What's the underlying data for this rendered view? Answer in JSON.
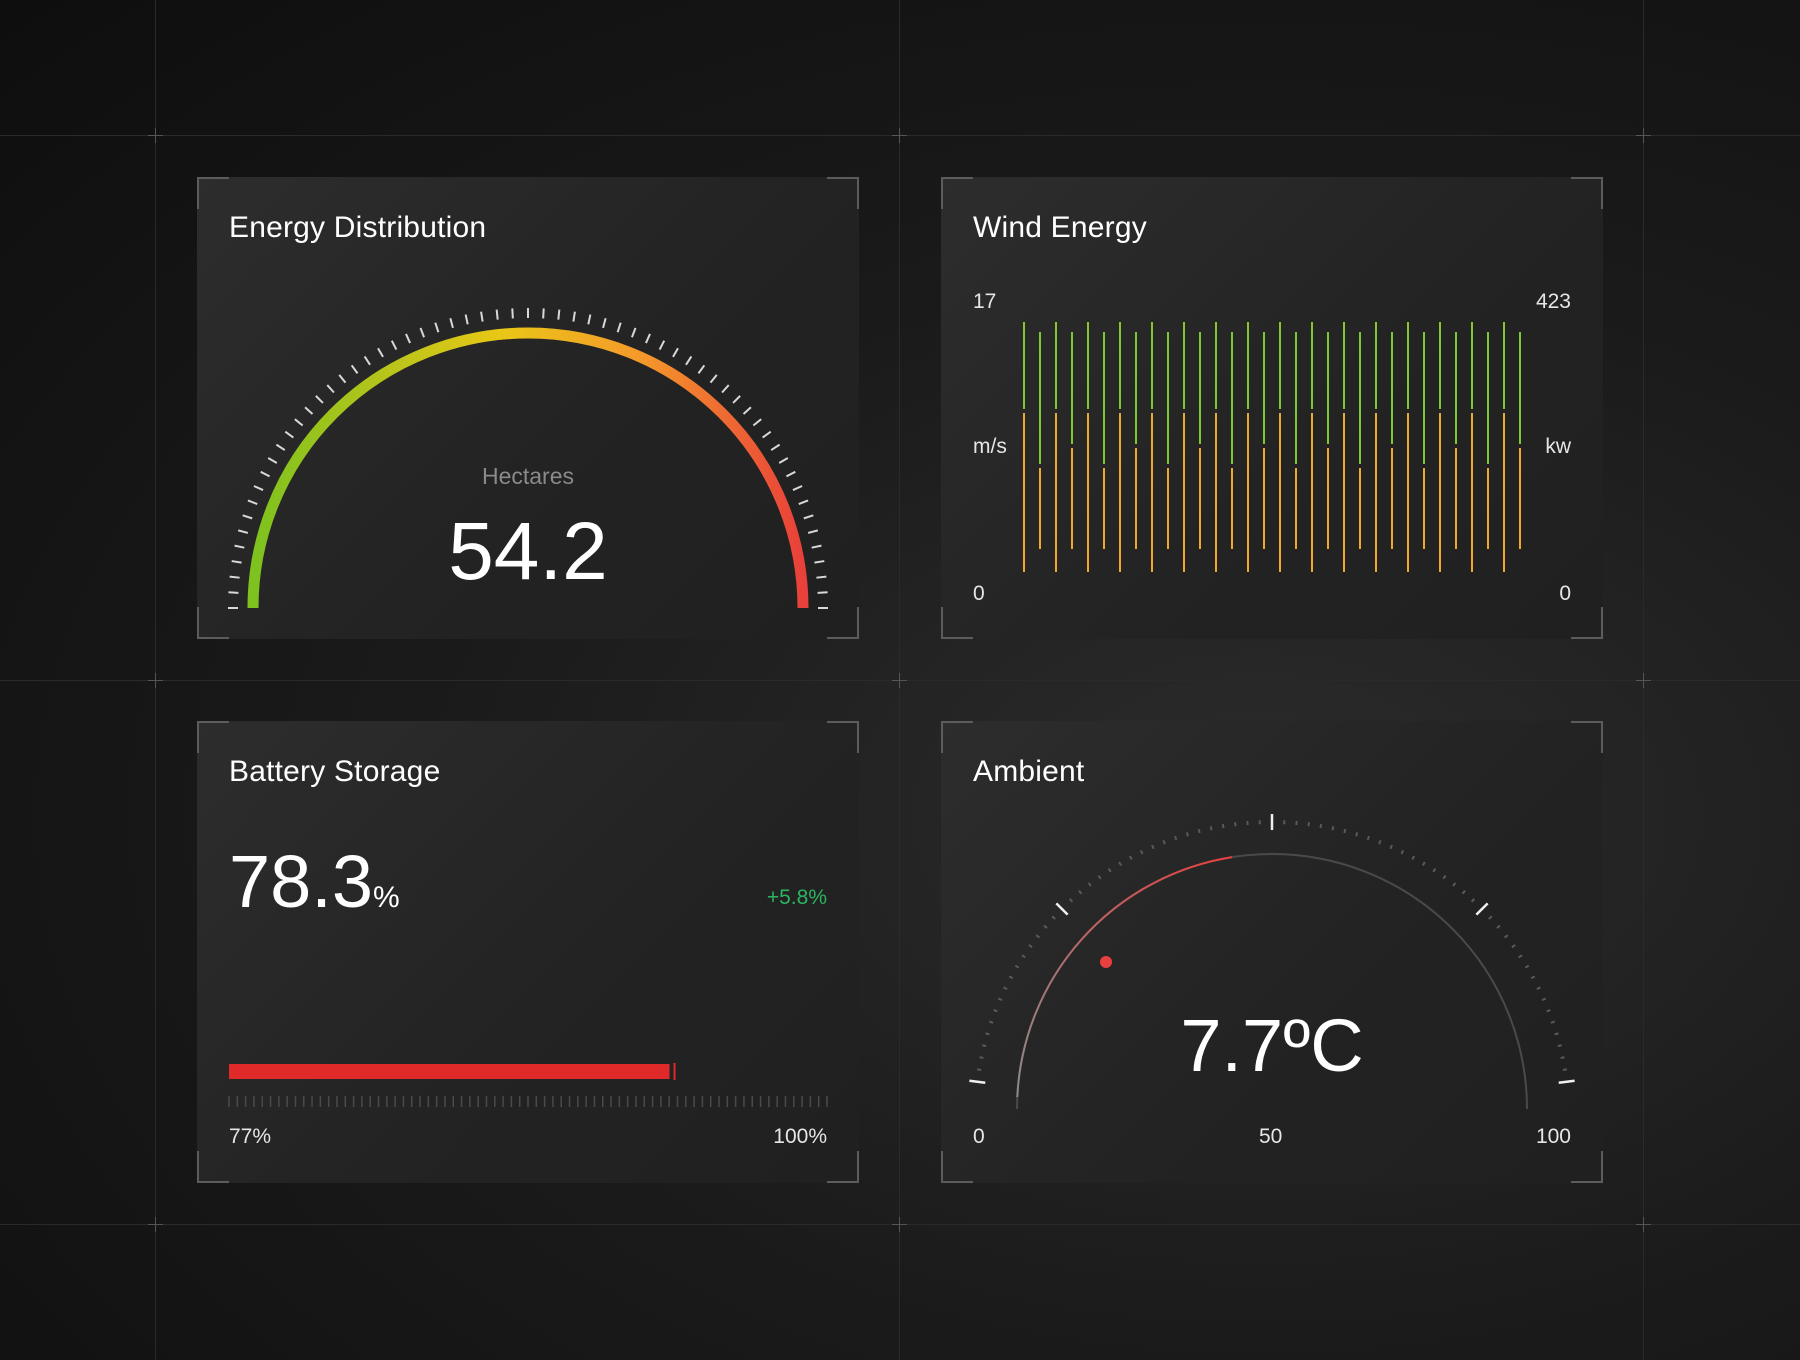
{
  "cards": {
    "energy": {
      "title": "Energy Distribution",
      "unit_label": "Hectares",
      "value": "54.2",
      "gauge_colors": [
        "#7dc21f",
        "#e9c716",
        "#f59a2a",
        "#e8403a"
      ]
    },
    "wind": {
      "title": "Wind Energy",
      "left_max": "17",
      "right_max": "423",
      "left_unit": "m/s",
      "right_unit": "kw",
      "left_min": "0",
      "right_min": "0",
      "series_colors": {
        "speed": "#7fc832",
        "power": "#f0a828"
      }
    },
    "battery": {
      "title": "Battery Storage",
      "value": "78.3",
      "value_unit": "%",
      "change": "+5.8%",
      "change_color": "#2bb562",
      "range_min_label": "77%",
      "range_max_label": "100%",
      "fill_fraction": 0.74,
      "bar_color": "#e02a2a"
    },
    "ambient": {
      "title": "Ambient",
      "value": "7.7ºC",
      "scale_min": "0",
      "scale_mid": "50",
      "scale_max": "100",
      "accent_color": "#e84040"
    }
  }
}
